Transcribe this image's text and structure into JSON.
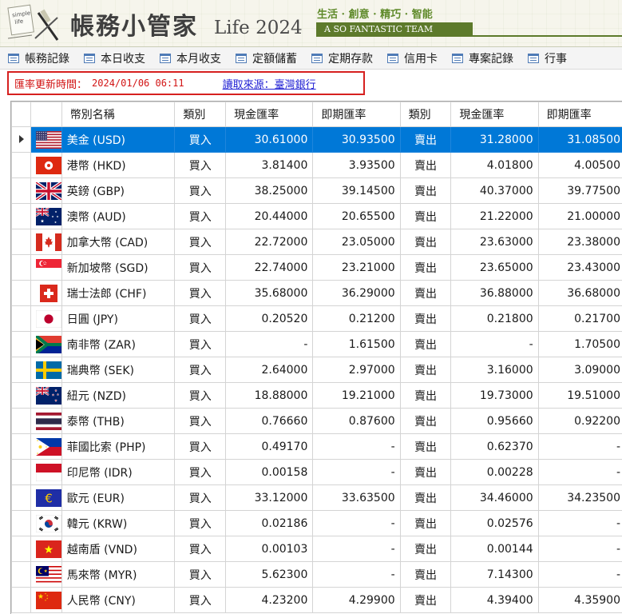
{
  "header": {
    "logo_text": [
      "simple",
      "life"
    ],
    "title": "帳務小管家",
    "version": "Life 2024",
    "slogan": "生活 · 創意 · 精巧 · 智能",
    "team": "A SO FANTASTIC TEAM"
  },
  "toolbar": {
    "items": [
      {
        "label": "帳務記錄",
        "icon": "list-icon"
      },
      {
        "label": "本日收支",
        "icon": "list-icon"
      },
      {
        "label": "本月收支",
        "icon": "list-icon"
      },
      {
        "label": "定額儲蓄",
        "icon": "list-icon"
      },
      {
        "label": "定期存款",
        "icon": "list-icon"
      },
      {
        "label": "信用卡",
        "icon": "list-icon"
      },
      {
        "label": "專案記錄",
        "icon": "list-icon"
      },
      {
        "label": "行事",
        "icon": "list-icon"
      }
    ]
  },
  "rate_info": {
    "label": "匯率更新時間：",
    "time": "2024/01/06 06:11",
    "source_link": "讀取來源：臺灣銀行"
  },
  "table": {
    "columns": [
      "幣別名稱",
      "類別",
      "現金匯率",
      "即期匯率",
      "類別",
      "現金匯率",
      "即期匯率"
    ],
    "selected_row_index": 0,
    "rows": [
      {
        "flag": "us",
        "name": "美金 (USD)",
        "buy_type": "買入",
        "buy_cash": "30.61000",
        "buy_spot": "30.93500",
        "sell_type": "賣出",
        "sell_cash": "31.28000",
        "sell_spot": "31.08500"
      },
      {
        "flag": "hk",
        "name": "港幣 (HKD)",
        "buy_type": "買入",
        "buy_cash": "3.81400",
        "buy_spot": "3.93500",
        "sell_type": "賣出",
        "sell_cash": "4.01800",
        "sell_spot": "4.00500"
      },
      {
        "flag": "gb",
        "name": "英鎊 (GBP)",
        "buy_type": "買入",
        "buy_cash": "38.25000",
        "buy_spot": "39.14500",
        "sell_type": "賣出",
        "sell_cash": "40.37000",
        "sell_spot": "39.77500"
      },
      {
        "flag": "au",
        "name": "澳幣 (AUD)",
        "buy_type": "買入",
        "buy_cash": "20.44000",
        "buy_spot": "20.65500",
        "sell_type": "賣出",
        "sell_cash": "21.22000",
        "sell_spot": "21.00000"
      },
      {
        "flag": "ca",
        "name": "加拿大幣 (CAD)",
        "buy_type": "買入",
        "buy_cash": "22.72000",
        "buy_spot": "23.05000",
        "sell_type": "賣出",
        "sell_cash": "23.63000",
        "sell_spot": "23.38000"
      },
      {
        "flag": "sg",
        "name": "新加坡幣 (SGD)",
        "buy_type": "買入",
        "buy_cash": "22.74000",
        "buy_spot": "23.21000",
        "sell_type": "賣出",
        "sell_cash": "23.65000",
        "sell_spot": "23.43000"
      },
      {
        "flag": "ch",
        "name": "瑞士法郎 (CHF)",
        "buy_type": "買入",
        "buy_cash": "35.68000",
        "buy_spot": "36.29000",
        "sell_type": "賣出",
        "sell_cash": "36.88000",
        "sell_spot": "36.68000"
      },
      {
        "flag": "jp",
        "name": "日圓 (JPY)",
        "buy_type": "買入",
        "buy_cash": "0.20520",
        "buy_spot": "0.21200",
        "sell_type": "賣出",
        "sell_cash": "0.21800",
        "sell_spot": "0.21700"
      },
      {
        "flag": "za",
        "name": "南非幣 (ZAR)",
        "buy_type": "買入",
        "buy_cash": "-",
        "buy_spot": "1.61500",
        "sell_type": "賣出",
        "sell_cash": "-",
        "sell_spot": "1.70500"
      },
      {
        "flag": "se",
        "name": "瑞典幣 (SEK)",
        "buy_type": "買入",
        "buy_cash": "2.64000",
        "buy_spot": "2.97000",
        "sell_type": "賣出",
        "sell_cash": "3.16000",
        "sell_spot": "3.09000"
      },
      {
        "flag": "nz",
        "name": "紐元 (NZD)",
        "buy_type": "買入",
        "buy_cash": "18.88000",
        "buy_spot": "19.21000",
        "sell_type": "賣出",
        "sell_cash": "19.73000",
        "sell_spot": "19.51000"
      },
      {
        "flag": "th",
        "name": "泰幣 (THB)",
        "buy_type": "買入",
        "buy_cash": "0.76660",
        "buy_spot": "0.87600",
        "sell_type": "賣出",
        "sell_cash": "0.95660",
        "sell_spot": "0.92200"
      },
      {
        "flag": "ph",
        "name": "菲國比索 (PHP)",
        "buy_type": "買入",
        "buy_cash": "0.49170",
        "buy_spot": "-",
        "sell_type": "賣出",
        "sell_cash": "0.62370",
        "sell_spot": "-"
      },
      {
        "flag": "id",
        "name": "印尼幣 (IDR)",
        "buy_type": "買入",
        "buy_cash": "0.00158",
        "buy_spot": "-",
        "sell_type": "賣出",
        "sell_cash": "0.00228",
        "sell_spot": "-"
      },
      {
        "flag": "eu",
        "name": "歐元 (EUR)",
        "buy_type": "買入",
        "buy_cash": "33.12000",
        "buy_spot": "33.63500",
        "sell_type": "賣出",
        "sell_cash": "34.46000",
        "sell_spot": "34.23500"
      },
      {
        "flag": "kr",
        "name": "韓元 (KRW)",
        "buy_type": "買入",
        "buy_cash": "0.02186",
        "buy_spot": "-",
        "sell_type": "賣出",
        "sell_cash": "0.02576",
        "sell_spot": "-"
      },
      {
        "flag": "vn",
        "name": "越南盾 (VND)",
        "buy_type": "買入",
        "buy_cash": "0.00103",
        "buy_spot": "-",
        "sell_type": "賣出",
        "sell_cash": "0.00144",
        "sell_spot": "-"
      },
      {
        "flag": "my",
        "name": "馬來幣 (MYR)",
        "buy_type": "買入",
        "buy_cash": "5.62300",
        "buy_spot": "-",
        "sell_type": "賣出",
        "sell_cash": "7.14300",
        "sell_spot": "-"
      },
      {
        "flag": "cn",
        "name": "人民幣 (CNY)",
        "buy_type": "買入",
        "buy_cash": "4.23200",
        "buy_spot": "4.29900",
        "sell_type": "賣出",
        "sell_cash": "4.39400",
        "sell_spot": "4.35900"
      }
    ]
  },
  "colors": {
    "selection": "#0078d7",
    "rate_info_border": "#d6201f",
    "rate_info_text": "#d21414",
    "link": "#2222d4",
    "team_bar": "#5d7a2b",
    "slogan": "#5f8a2a"
  }
}
